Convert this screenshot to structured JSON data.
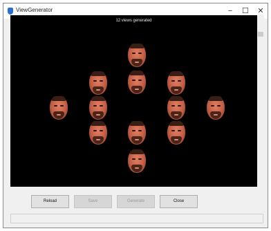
{
  "window": {
    "title": "ViewGenerator",
    "controls": {
      "minimize": "−",
      "maximize": "☐",
      "close": "✕"
    }
  },
  "viewport": {
    "caption": "12 views generated",
    "background": "#000000",
    "views": [
      "Front view",
      "Upper-left view",
      "Upper view",
      "Upper-right view",
      "Left view",
      "Left-center view",
      "Right-center view",
      "Right view",
      "Lower-left view",
      "Lower view",
      "Lower-right view",
      "Bottom view"
    ]
  },
  "buttons": {
    "reload": "Reload",
    "save": "Save",
    "generate": "Generate",
    "close": "Close"
  },
  "icons": {
    "app": "app-icon",
    "face": "face-thumbnail-icon"
  }
}
